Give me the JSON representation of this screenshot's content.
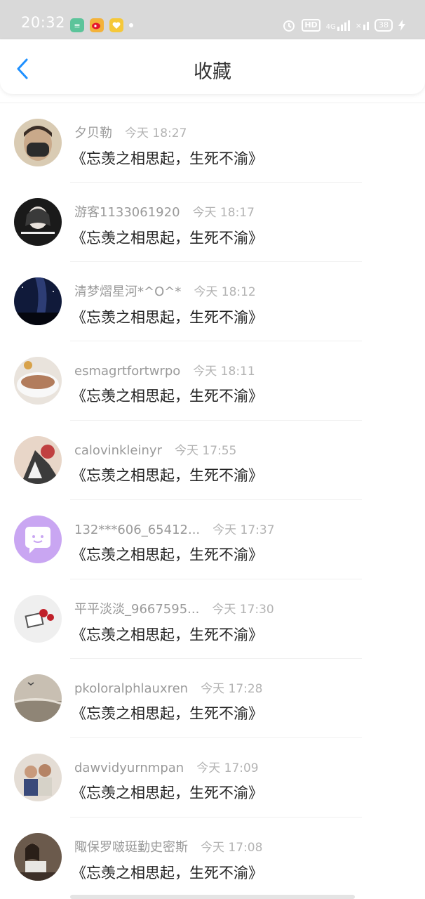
{
  "status_bar": {
    "time": "20:32",
    "hd_label": "HD",
    "network_label": "4G",
    "battery_level": "38"
  },
  "header": {
    "title": "收藏"
  },
  "items": [
    {
      "name": "夕贝勒",
      "time": "今天 18:27",
      "content": "《忘羡之相思起，生死不渝》"
    },
    {
      "name": "游客1133061920",
      "time": "今天 18:17",
      "content": "《忘羡之相思起，生死不渝》"
    },
    {
      "name": "清梦熠星河*^O^*",
      "time": "今天 18:12",
      "content": "《忘羡之相思起，生死不渝》"
    },
    {
      "name": "esmagrtfortwrpo",
      "time": "今天 18:11",
      "content": "《忘羡之相思起，生死不渝》"
    },
    {
      "name": "calovinkleinyr",
      "time": "今天 17:55",
      "content": "《忘羡之相思起，生死不渝》"
    },
    {
      "name": "132***606_65412...",
      "time": "今天 17:37",
      "content": "《忘羡之相思起，生死不渝》"
    },
    {
      "name": "平平淡淡_9667595...",
      "time": "今天 17:30",
      "content": "《忘羡之相思起，生死不渝》"
    },
    {
      "name": "pkoloralphlauxren",
      "time": "今天 17:28",
      "content": "《忘羡之相思起，生死不渝》"
    },
    {
      "name": "dawvidyurnmpan",
      "time": "今天 17:09",
      "content": "《忘羡之相思起，生死不渝》"
    },
    {
      "name": "陬保罗啵珽勤史密斯",
      "time": "今天 17:08",
      "content": "《忘羡之相思起，生死不渝》"
    }
  ],
  "colors": {
    "accent": "#1e90ff",
    "status_bar_bg": "#d9d9d9"
  }
}
